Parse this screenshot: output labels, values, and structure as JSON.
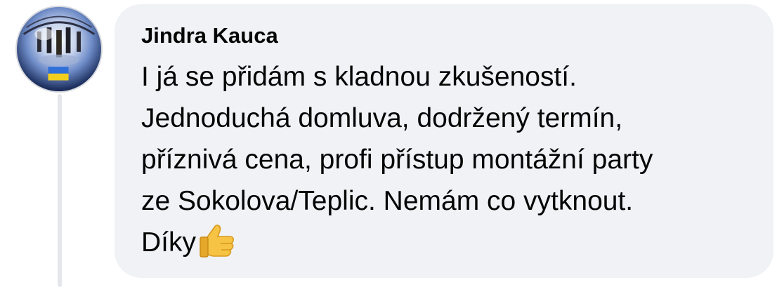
{
  "comment": {
    "author": "Jindra Kauca",
    "lines": [
      "I já se přidám s kladnou zkušeností.",
      "Jednoduchá domluva, dodržený termín,",
      "příznivá cena, profi přístup montážní party",
      "ze Sokolova/Teplic. Nemám co vytknout.",
      "Díky"
    ],
    "emoji": "thumbs-up-icon"
  },
  "colors": {
    "bubble_background": "#f0f2f5",
    "text": "#050505",
    "thread_line": "#e4e6eb"
  }
}
